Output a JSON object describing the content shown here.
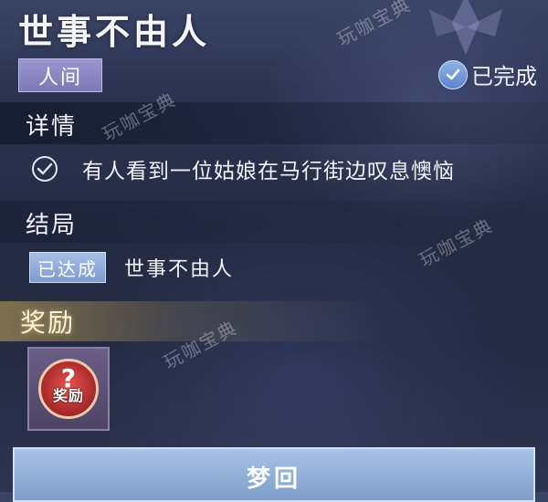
{
  "quest": {
    "title": "世事不由人",
    "location": "人间",
    "status": "已完成"
  },
  "details": {
    "label": "详情",
    "task": "有人看到一位姑娘在马行街边叹息懊恼"
  },
  "ending": {
    "label": "结局",
    "badge": "已达成",
    "name": "世事不由人"
  },
  "rewards": {
    "label": "奖励",
    "item_label": "奖励",
    "item_symbol": "?"
  },
  "action": {
    "button_label": "梦回"
  },
  "watermark": "玩咖宝典",
  "colors": {
    "accent": "#8fb1ea",
    "location_tag": "#9c96cf",
    "reward_band": "#c8aa5a"
  }
}
